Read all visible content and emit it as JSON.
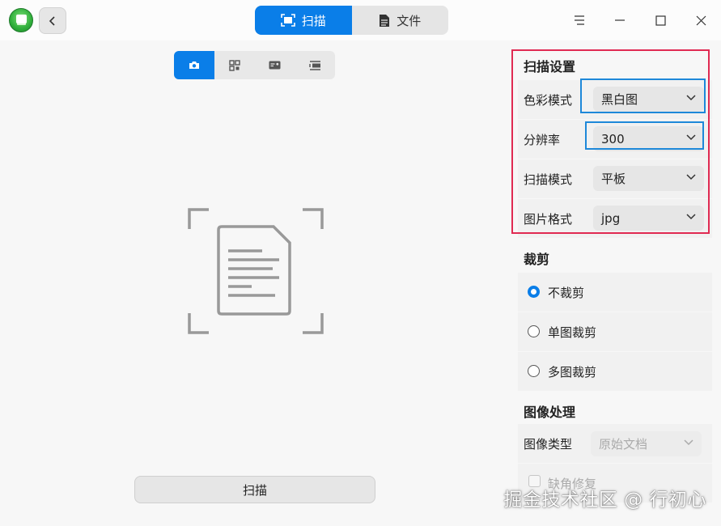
{
  "tabs": [
    {
      "label": "扫描",
      "icon": "scan-icon",
      "active": true
    },
    {
      "label": "文件",
      "icon": "file-icon",
      "active": false
    }
  ],
  "window_controls": [
    "menu-icon",
    "minimize-icon",
    "maximize-icon",
    "close-icon"
  ],
  "scan_modes": [
    "camera-icon",
    "qr-scan-icon",
    "id-card-icon",
    "document-feed-icon"
  ],
  "left": {
    "scan_button": "扫描"
  },
  "scan_settings": {
    "title": "扫描设置",
    "color_mode": {
      "label": "色彩模式",
      "value": "黑白图"
    },
    "resolution": {
      "label": "分辨率",
      "value": "300"
    },
    "scan_mode": {
      "label": "扫描模式",
      "value": "平板"
    },
    "image_format": {
      "label": "图片格式",
      "value": "jpg"
    }
  },
  "crop": {
    "title": "裁剪",
    "options": [
      "不裁剪",
      "单图裁剪",
      "多图裁剪"
    ],
    "selected": "不裁剪"
  },
  "image_processing": {
    "title": "图像处理",
    "image_type": {
      "label": "图像类型",
      "value": "原始文档"
    },
    "corner_repair": {
      "label": "缺角修复"
    }
  },
  "watermark": "掘金技术社区 @ 行初心",
  "colors": {
    "accent": "#0a7ee8",
    "highlight_red": "#e02a52",
    "highlight_blue": "#1e88d9"
  }
}
